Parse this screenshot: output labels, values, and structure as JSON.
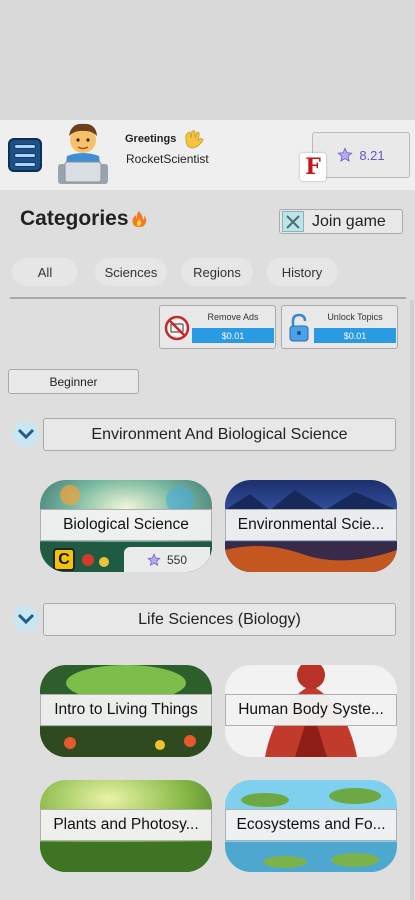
{
  "header": {
    "greeting": "Greetings",
    "username": "RocketScientist",
    "score": "8.21",
    "logo_letter": "F"
  },
  "categories": {
    "title": "Categories",
    "join_label": "Join game"
  },
  "tabs": [
    "All",
    "Sciences",
    "Regions",
    "History"
  ],
  "purchases": {
    "remove_ads": {
      "label": "Remove Ads",
      "price": "$0.01"
    },
    "unlock_topics": {
      "label": "Unlock Topics",
      "price": "$0.01"
    }
  },
  "level": "Beginner",
  "sections": [
    {
      "title": "Environment And Biological Science",
      "cards": [
        {
          "label": "Biological Science",
          "stars": "550"
        },
        {
          "label": "Environmental Scie..."
        }
      ]
    },
    {
      "title": "Life Sciences (Biology)",
      "cards": [
        {
          "label": "Intro to Living Things"
        },
        {
          "label": "Human Body Syste..."
        },
        {
          "label": "Plants and Photosy..."
        },
        {
          "label": "Ecosystems and Fo..."
        }
      ]
    }
  ],
  "colors": {
    "accent_blue": "#2a9be3",
    "star_purple": "#6a55c9",
    "menu_blue": "#1f4f86"
  }
}
